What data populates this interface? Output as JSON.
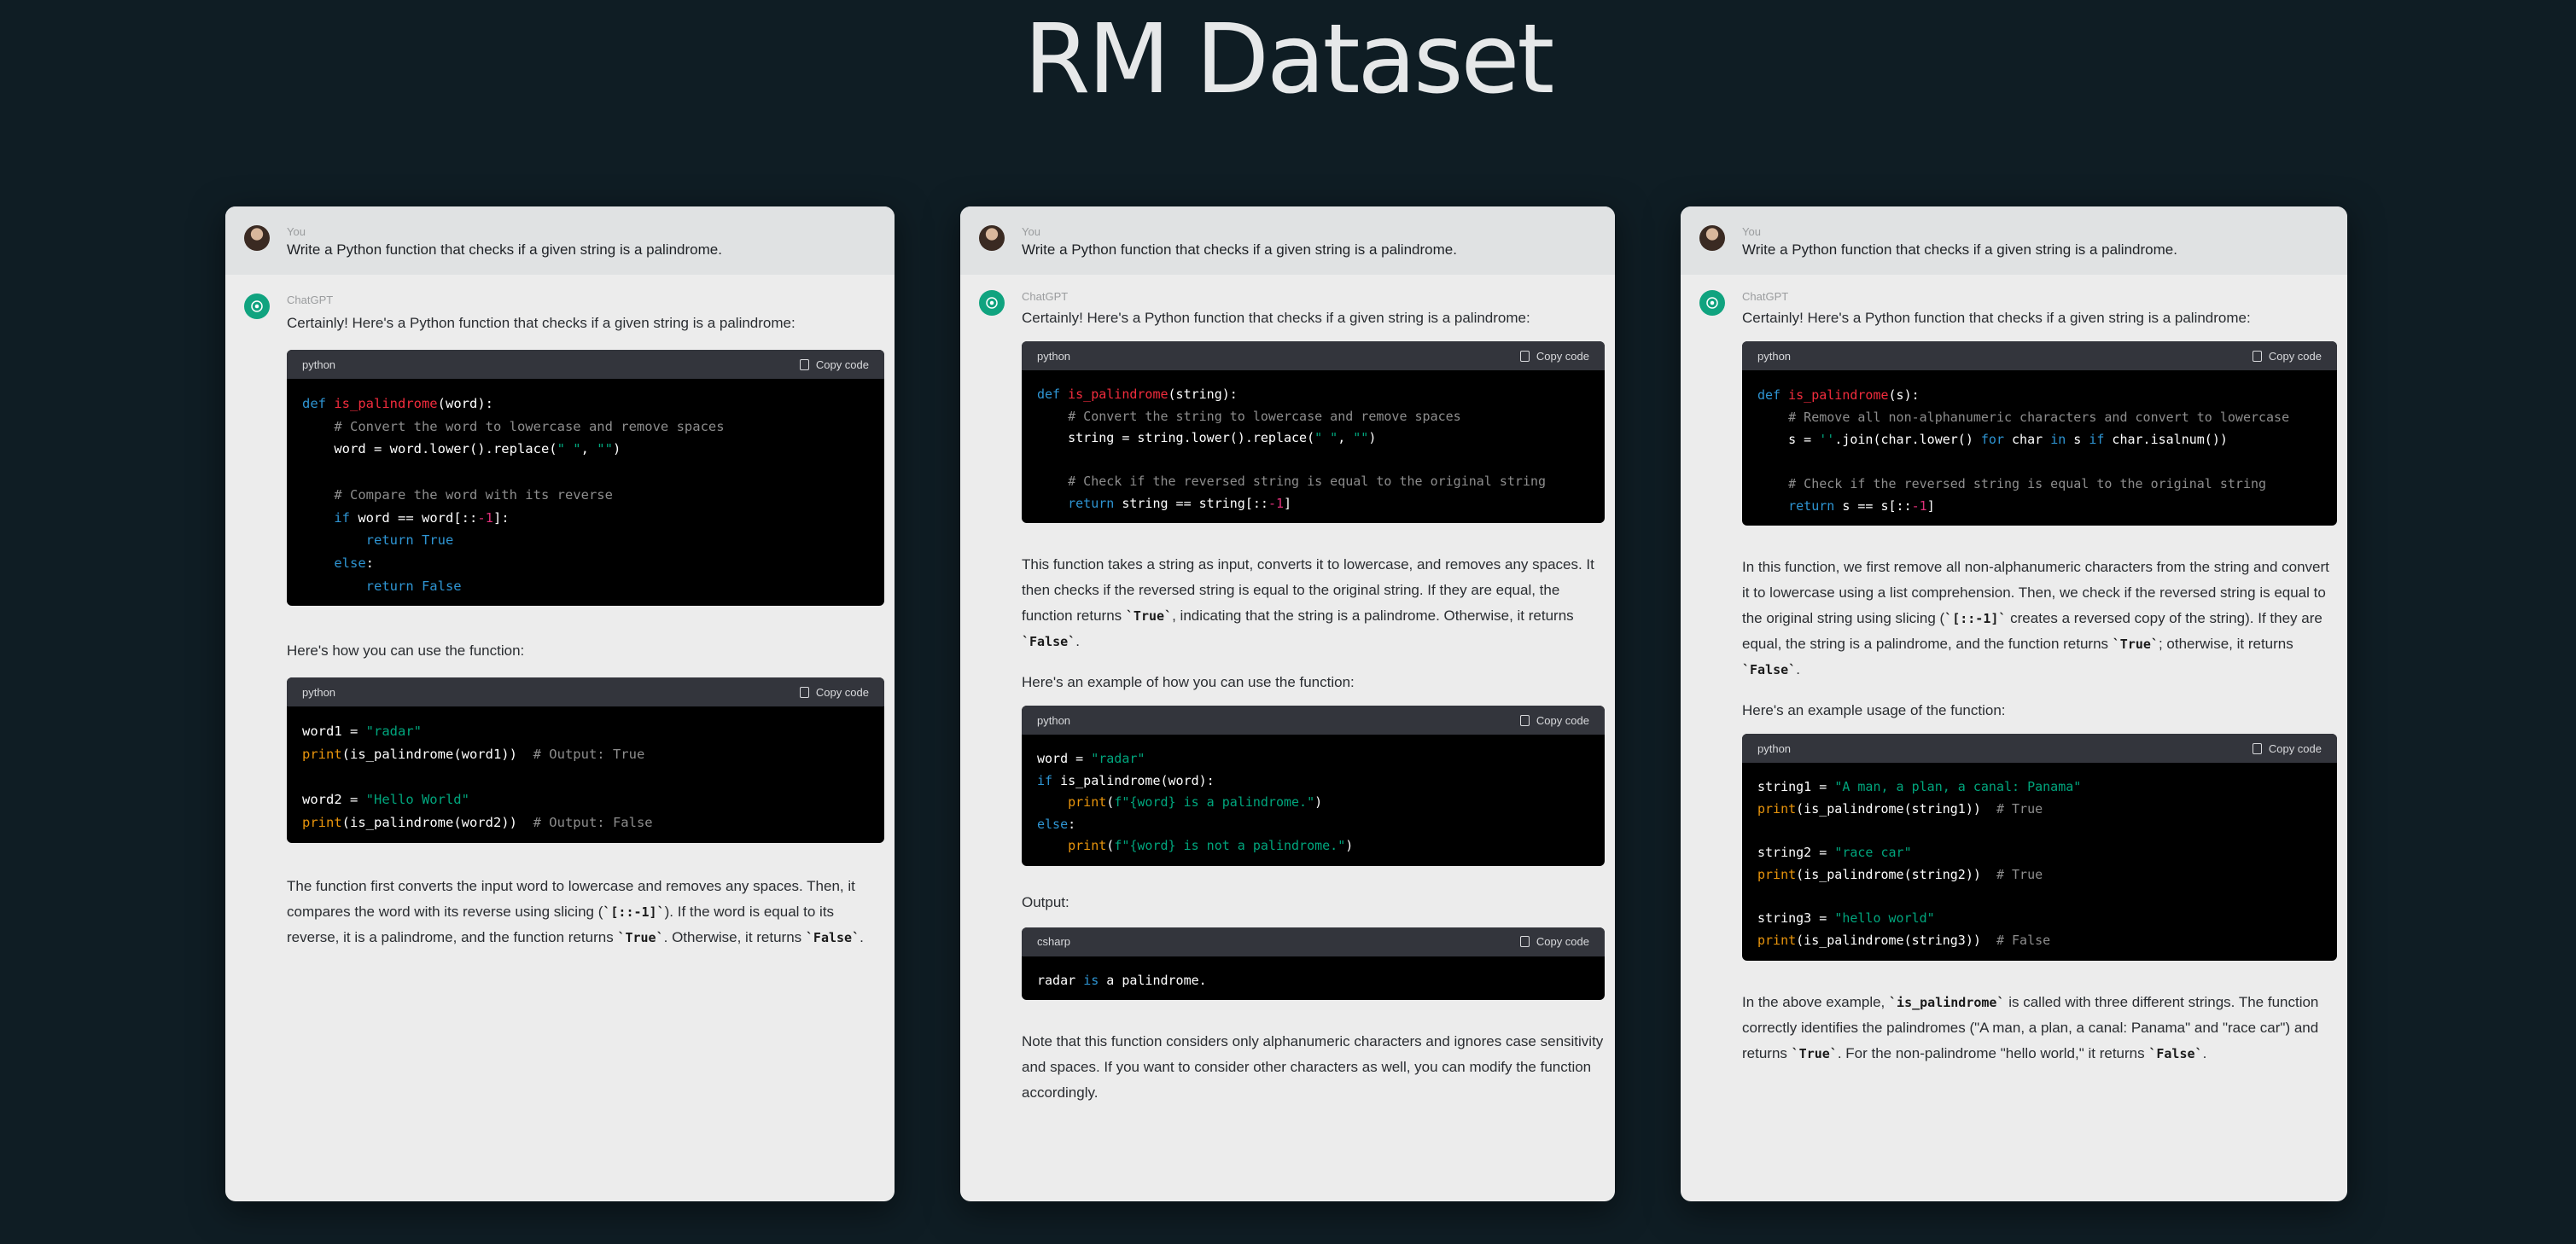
{
  "page": {
    "title": "RM Dataset"
  },
  "panels": [
    {
      "user": {
        "name": "You",
        "prompt": "Write a Python function that checks if a given string is a palindrome."
      },
      "assistant": {
        "name": "ChatGPT",
        "intro": "Certainly! Here's a Python function that checks if a given string is a palindrome:",
        "code_1": {
          "lang": "python",
          "copy_label": "Copy code"
        },
        "usage_intro": "Here's how you can use the function:",
        "code_2": {
          "lang": "python",
          "copy_label": "Copy code"
        },
        "explanation": {
          "t1": "The function first converts the input word to lowercase and removes any spaces. Then, it compares the word with its reverse using slicing (",
          "c1": "`[::-1]`",
          "t2": "). If the word is equal to its reverse, it is a palindrome, and the function returns ",
          "c2": "`True`",
          "t3": ". Otherwise, it returns ",
          "c3": "`False`",
          "t4": "."
        }
      }
    },
    {
      "user": {
        "name": "You",
        "prompt": "Write a Python function that checks if a given string is a palindrome."
      },
      "assistant": {
        "name": "ChatGPT",
        "intro": "Certainly! Here's a Python function that checks if a given string is a palindrome:",
        "code_1": {
          "lang": "python",
          "copy_label": "Copy code"
        },
        "explanation": {
          "t1": "This function takes a string as input, converts it to lowercase, and removes any spaces. It then checks if the reversed string is equal to the original string. If they are equal, the function returns ",
          "c1": "`True`",
          "t2": ", indicating that the string is a palindrome. Otherwise, it returns ",
          "c2": "`False`",
          "t3": "."
        },
        "usage_intro": "Here's an example of how you can use the function:",
        "code_2": {
          "lang": "python",
          "copy_label": "Copy code"
        },
        "output_label": "Output:",
        "code_3": {
          "lang": "csharp",
          "copy_label": "Copy code"
        },
        "note": "Note that this function considers only alphanumeric characters and ignores case sensitivity and spaces. If you want to consider other characters as well, you can modify the function accordingly."
      }
    },
    {
      "user": {
        "name": "You",
        "prompt": "Write a Python function that checks if a given string is a palindrome."
      },
      "assistant": {
        "name": "ChatGPT",
        "intro": "Certainly! Here's a Python function that checks if a given string is a palindrome:",
        "code_1": {
          "lang": "python",
          "copy_label": "Copy code"
        },
        "explanation": {
          "t1": "In this function, we first remove all non-alphanumeric characters from the string and convert it to lowercase using a list comprehension. Then, we check if the reversed string is equal to the original string using slicing (",
          "c1": "`[::-1]`",
          "t2": " creates a reversed copy of the string). If they are equal, the string is a palindrome, and the function returns ",
          "c2": "`True`",
          "t3": "; otherwise, it returns ",
          "c3": "`False`",
          "t4": "."
        },
        "usage_intro": "Here's an example usage of the function:",
        "code_2": {
          "lang": "python",
          "copy_label": "Copy code"
        },
        "summary": {
          "t1": "In the above example, ",
          "c1": "`is_palindrome`",
          "t2": " is called with three different strings. The function correctly identifies the palindromes (\"A man, a plan, a canal: Panama\" and \"race car\") and returns ",
          "c2": "`True`",
          "t3": ". For the non-palindrome \"hello world,\" it returns ",
          "c3": "`False`",
          "t4": "."
        }
      }
    }
  ],
  "code": {
    "p1c1": [
      [
        [
          "k",
          "def "
        ],
        [
          "f",
          "is_palindrome"
        ],
        [
          "",
          "(word):"
        ]
      ],
      [
        [
          "c",
          "    # Convert the word to lowercase and remove spaces"
        ]
      ],
      [
        [
          "",
          "    word = word.lower().replace("
        ],
        [
          "s",
          "\" \""
        ],
        [
          "",
          ", "
        ],
        [
          "s",
          "\"\""
        ],
        [
          "",
          ")"
        ]
      ],
      [
        [
          "",
          ""
        ]
      ],
      [
        [
          "c",
          "    # Compare the word with its reverse"
        ]
      ],
      [
        [
          "k",
          "    if"
        ],
        [
          "",
          " word == word[::"
        ],
        [
          "n",
          "-1"
        ],
        [
          "",
          "]:"
        ]
      ],
      [
        [
          "k",
          "        return True"
        ]
      ],
      [
        [
          "k",
          "    else"
        ],
        [
          "",
          ":"
        ]
      ],
      [
        [
          "k",
          "        return False"
        ]
      ]
    ],
    "p1c2": [
      [
        [
          "",
          "word1 = "
        ],
        [
          "s",
          "\"radar\""
        ]
      ],
      [
        [
          "b",
          "print"
        ],
        [
          "",
          "(is_palindrome(word1))  "
        ],
        [
          "c",
          "# Output: True"
        ]
      ],
      [
        [
          "",
          ""
        ]
      ],
      [
        [
          "",
          "word2 = "
        ],
        [
          "s",
          "\"Hello World\""
        ]
      ],
      [
        [
          "b",
          "print"
        ],
        [
          "",
          "(is_palindrome(word2))  "
        ],
        [
          "c",
          "# Output: False"
        ]
      ]
    ],
    "p2c1": [
      [
        [
          "k",
          "def "
        ],
        [
          "f",
          "is_palindrome"
        ],
        [
          "",
          "(string):"
        ]
      ],
      [
        [
          "c",
          "    # Convert the string to lowercase and remove spaces"
        ]
      ],
      [
        [
          "",
          "    string = string.lower().replace("
        ],
        [
          "s",
          "\" \""
        ],
        [
          "",
          ", "
        ],
        [
          "s",
          "\"\""
        ],
        [
          "",
          ")"
        ]
      ],
      [
        [
          "",
          ""
        ]
      ],
      [
        [
          "c",
          "    # Check if the reversed string is equal to the original string"
        ]
      ],
      [
        [
          "k",
          "    return"
        ],
        [
          "",
          " string == string[::"
        ],
        [
          "n",
          "-1"
        ],
        [
          "",
          "]"
        ]
      ]
    ],
    "p2c2": [
      [
        [
          "",
          "word = "
        ],
        [
          "s",
          "\"radar\""
        ]
      ],
      [
        [
          "k",
          "if"
        ],
        [
          "",
          " is_palindrome(word):"
        ]
      ],
      [
        [
          "b",
          "    print"
        ],
        [
          "",
          "("
        ],
        [
          "s",
          "f\"{word} is a palindrome.\""
        ],
        [
          "",
          ")"
        ]
      ],
      [
        [
          "k",
          "else"
        ],
        [
          "",
          ":"
        ]
      ],
      [
        [
          "b",
          "    print"
        ],
        [
          "",
          "("
        ],
        [
          "s",
          "f\"{word} is not a palindrome.\""
        ],
        [
          "",
          ")"
        ]
      ]
    ],
    "p2c3": [
      [
        [
          "",
          "radar "
        ],
        [
          "k",
          "is"
        ],
        [
          "",
          " a palindrome."
        ]
      ]
    ],
    "p3c1": [
      [
        [
          "k",
          "def "
        ],
        [
          "f",
          "is_palindrome"
        ],
        [
          "",
          "(s):"
        ]
      ],
      [
        [
          "c",
          "    # Remove all non-alphanumeric characters and convert to lowercase"
        ]
      ],
      [
        [
          "",
          "    s = "
        ],
        [
          "s",
          "''"
        ],
        [
          "",
          ".join(char.lower() "
        ],
        [
          "k",
          "for"
        ],
        [
          "",
          " char "
        ],
        [
          "k",
          "in"
        ],
        [
          "",
          " s "
        ],
        [
          "k",
          "if"
        ],
        [
          "",
          " char.isalnum())"
        ]
      ],
      [
        [
          "",
          ""
        ]
      ],
      [
        [
          "c",
          "    # Check if the reversed string is equal to the original string"
        ]
      ],
      [
        [
          "k",
          "    return"
        ],
        [
          "",
          " s == s[::"
        ],
        [
          "n",
          "-1"
        ],
        [
          "",
          "]"
        ]
      ]
    ],
    "p3c2": [
      [
        [
          "",
          "string1 = "
        ],
        [
          "s",
          "\"A man, a plan, a canal: Panama\""
        ]
      ],
      [
        [
          "b",
          "print"
        ],
        [
          "",
          "(is_palindrome(string1))  "
        ],
        [
          "c",
          "# True"
        ]
      ],
      [
        [
          "",
          ""
        ]
      ],
      [
        [
          "",
          "string2 = "
        ],
        [
          "s",
          "\"race car\""
        ]
      ],
      [
        [
          "b",
          "print"
        ],
        [
          "",
          "(is_palindrome(string2))  "
        ],
        [
          "c",
          "# True"
        ]
      ],
      [
        [
          "",
          ""
        ]
      ],
      [
        [
          "",
          "string3 = "
        ],
        [
          "s",
          "\"hello world\""
        ]
      ],
      [
        [
          "b",
          "print"
        ],
        [
          "",
          "(is_palindrome(string3))  "
        ],
        [
          "c",
          "# False"
        ]
      ]
    ]
  }
}
